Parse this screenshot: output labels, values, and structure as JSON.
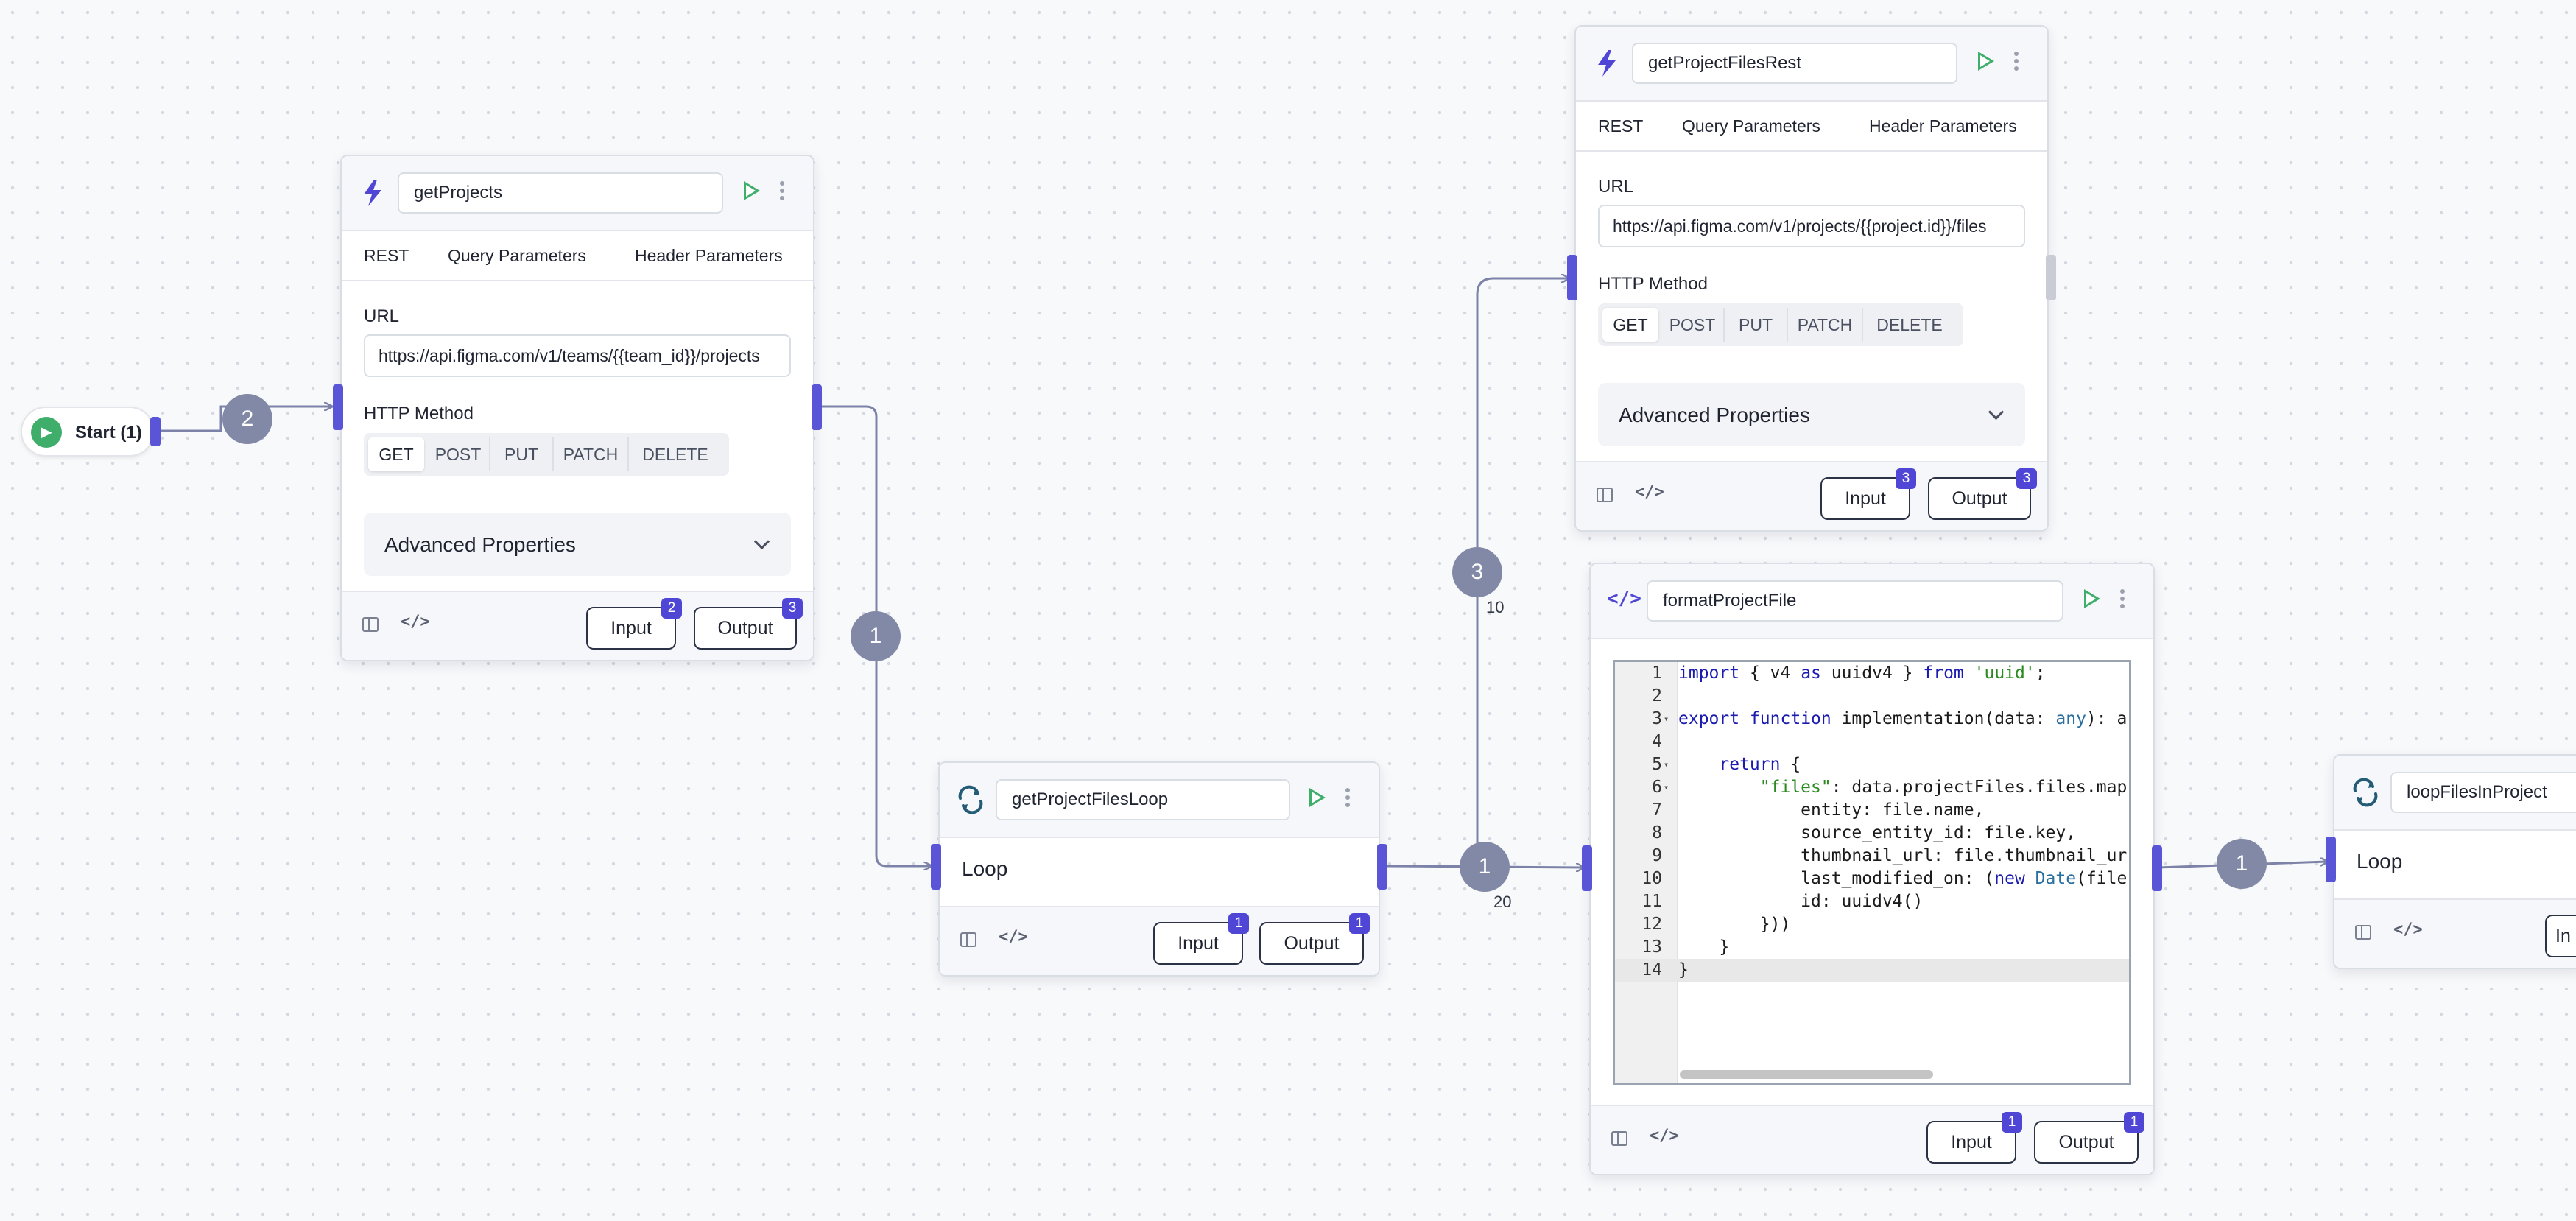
{
  "start": {
    "label": "Start (1)"
  },
  "edges": {
    "b1": "2",
    "b2": "1",
    "b3": "3",
    "b4": "1",
    "b5": "1",
    "count_top": "10",
    "count_mid": "20"
  },
  "nodes": {
    "getProjects": {
      "name": "getProjects",
      "tabs": [
        "REST",
        "Query Parameters",
        "Header Parameters"
      ],
      "url_label": "URL",
      "url": "https://api.figma.com/v1/teams/{{team_id}}/projects",
      "method_label": "HTTP Method",
      "methods": [
        "GET",
        "POST",
        "PUT",
        "PATCH",
        "DELETE"
      ],
      "selected_method": "GET",
      "advanced": "Advanced Properties",
      "input_label": "Input",
      "input_count": "2",
      "output_label": "Output",
      "output_count": "3"
    },
    "getProjectFilesRest": {
      "name": "getProjectFilesRest",
      "tabs": [
        "REST",
        "Query Parameters",
        "Header Parameters"
      ],
      "url_label": "URL",
      "url": "https://api.figma.com/v1/projects/{{project.id}}/files",
      "method_label": "HTTP Method",
      "methods": [
        "GET",
        "POST",
        "PUT",
        "PATCH",
        "DELETE"
      ],
      "selected_method": "GET",
      "advanced": "Advanced Properties",
      "input_label": "Input",
      "input_count": "3",
      "output_label": "Output",
      "output_count": "3"
    },
    "getProjectFilesLoop": {
      "name": "getProjectFilesLoop",
      "body": "Loop",
      "input_label": "Input",
      "input_count": "1",
      "output_label": "Output",
      "output_count": "1"
    },
    "formatProjectFile": {
      "name": "formatProjectFile",
      "code_lines": [
        "import { v4 as uuidv4 } from 'uuid';",
        "",
        "export function implementation(data: any): a",
        "",
        "    return {",
        "        \"files\": data.projectFiles.files.map",
        "            entity: file.name,",
        "            source_entity_id: file.key,",
        "            thumbnail_url: file.thumbnail_ur",
        "            last_modified_on: (new Date(file",
        "            id: uuidv4()",
        "        }))",
        "    }",
        "}"
      ],
      "input_label": "Input",
      "input_count": "1",
      "output_label": "Output",
      "output_count": "1"
    },
    "loopFilesInProject": {
      "name": "loopFilesInProject",
      "body": "Loop",
      "input_label": "In"
    }
  },
  "colors": {
    "handle": "#5a55d6",
    "edge": "#7d83a8",
    "badge": "#8289a6",
    "run": "#3fae6b",
    "count": "#4f46d6"
  },
  "icons": {
    "rest": "bolt-icon",
    "loop": "loop-icon",
    "code": "code-icon",
    "run": "play-icon",
    "more": "more-vertical-icon"
  }
}
